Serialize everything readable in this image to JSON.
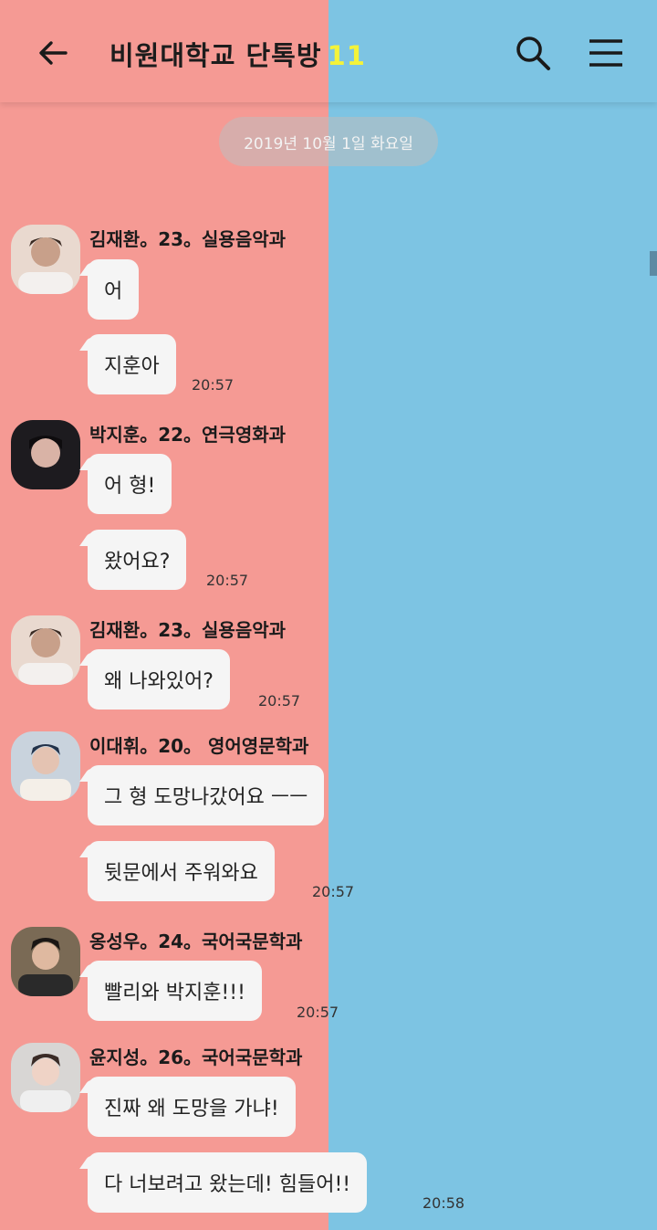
{
  "header": {
    "title": "비원대학교 단톡방",
    "member_count": "11",
    "back_icon": "arrow-left-icon",
    "search_icon": "search-icon",
    "menu_icon": "hamburger-menu-icon"
  },
  "date_divider": "2019년 10월 1일 화요일",
  "messages": [
    {
      "sender": "김재환。23。실용음악과",
      "texts": [
        "어",
        "지훈아"
      ],
      "time": "20:57"
    },
    {
      "sender": "박지훈。22。연극영화과",
      "texts": [
        "어 형!",
        "왔어요?"
      ],
      "time": "20:57"
    },
    {
      "sender": "김재환。23。실용음악과",
      "texts": [
        "왜 나와있어?"
      ],
      "time": "20:57"
    },
    {
      "sender": "이대휘。20。 영어영문학과",
      "texts": [
        "그 형 도망나갔어요 ㅡㅡ",
        "뒷문에서 주워와요"
      ],
      "time": "20:57"
    },
    {
      "sender": "옹성우。24。국어국문학과",
      "texts": [
        "빨리와 박지훈!!!"
      ],
      "time": "20:57"
    },
    {
      "sender": "윤지성。26。국어국문학과",
      "texts": [
        "진짜 왜 도망을 가냐!",
        "다 너보려고 왔는데! 힘들어!!"
      ],
      "time": "20:58"
    }
  ],
  "colors": {
    "left_bg": "#f59a94",
    "right_bg": "#7dc4e3",
    "count": "#f4f33a",
    "bubble": "#f5f5f5"
  }
}
